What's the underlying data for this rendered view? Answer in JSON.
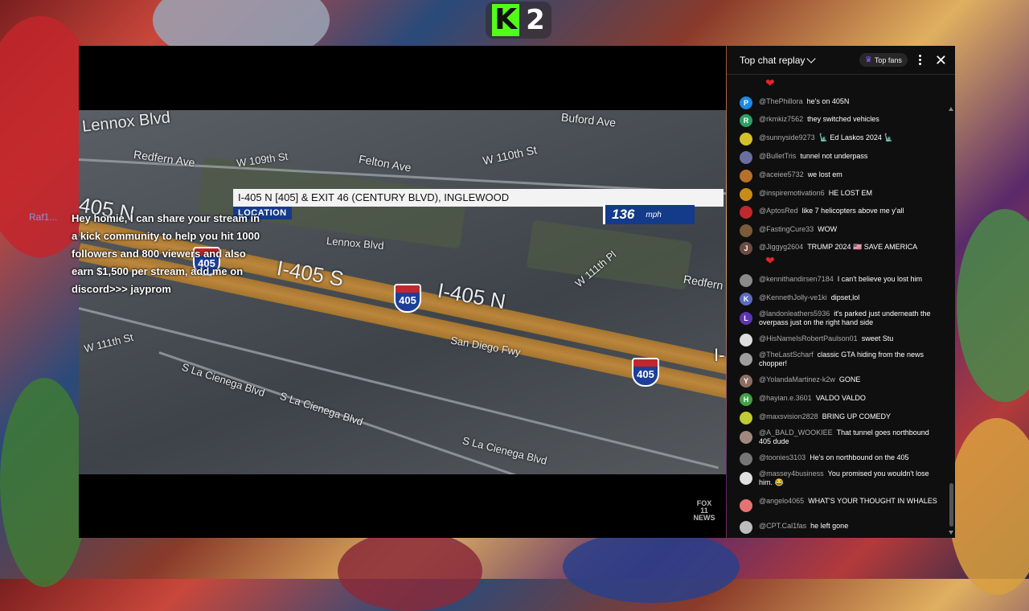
{
  "kick": {
    "logo_text": "K",
    "count": "2",
    "brand_color": "#53fc18"
  },
  "video": {
    "location_text": "I-405 N [405] & EXIT 46 (CENTURY BLVD), INGLEWOOD",
    "location_tag": "LOCATION",
    "speed_value": "136",
    "speed_unit": "mph",
    "map_labels": [
      "Lennox Blvd",
      "Redfern Ave",
      "W 109th St",
      "Felton Ave",
      "W 110th St",
      "Buford Ave",
      "405 N",
      "Lennox Blvd",
      "I-405 S",
      "I-405 N",
      "W 111th Pl",
      "Redfern",
      "W 111th St",
      "San Diego Fwy",
      "S La Cienega Blvd",
      "S La Cienega Blvd",
      "S La Cienega Blvd",
      "I-"
    ],
    "shields": [
      "405",
      "405",
      "405"
    ],
    "channel_logo": "FOX 11 NEWS",
    "overlay_user": "Raf1...",
    "overlay_message": "Hey homie, I can share your stream in a kick community to help you hit 1000 followers and 800 viewers and also earn $1,500 per stream, add me on discord>>> jayprom"
  },
  "chat": {
    "title": "Top chat replay",
    "top_fans_label": "Top fans",
    "messages": [
      {
        "author": "@ThePhillora",
        "text": "he's on 405N",
        "avatar_letter": "P",
        "avatar_color": "#1e88e5"
      },
      {
        "author": "@rkmkiz7562",
        "text": "they switched vehicles",
        "avatar_letter": "R",
        "avatar_color": "#2e9e63"
      },
      {
        "author": "@sunnyside9273",
        "text": "🗽 Ed Laskos 2024 🗽",
        "avatar_letter": "",
        "avatar_color": "#d4c12a"
      },
      {
        "author": "@BulletTris",
        "text": "tunnel not underpass",
        "avatar_letter": "",
        "avatar_color": "#6a6fa0"
      },
      {
        "author": "@aceiee5732",
        "text": "we lost em",
        "avatar_letter": "",
        "avatar_color": "#b5702a"
      },
      {
        "author": "@inspiremotivation6",
        "text": "HE LOST EM",
        "avatar_letter": "",
        "avatar_color": "#c98a1a"
      },
      {
        "author": "@AptosRed",
        "text": "like 7 helicopters above me y'all",
        "avatar_letter": "",
        "avatar_color": "#c0282d"
      },
      {
        "author": "@FastingCure33",
        "text": "WOW",
        "avatar_letter": "",
        "avatar_color": "#7a5a3a"
      },
      {
        "author": "@Jiggyg2604",
        "text": "TRUMP 2024 🇺🇸 SAVE AMERICA",
        "avatar_letter": "J",
        "avatar_color": "#6d4c41"
      },
      {
        "author": "@kennithandirsen7184",
        "text": "I can't believe you lost him",
        "avatar_letter": "",
        "avatar_color": "#8a8a8a"
      },
      {
        "author": "@KennethJolly-ve1ki",
        "text": "dipset,lol",
        "avatar_letter": "K",
        "avatar_color": "#5c6bc0"
      },
      {
        "author": "@landonleathers5936",
        "text": "it's parked just underneath the overpass just on the right hand side",
        "avatar_letter": "L",
        "avatar_color": "#5e35b1"
      },
      {
        "author": "@HisNameIsRobertPaulson01",
        "text": "sweet Stu",
        "avatar_letter": "",
        "avatar_color": "#dddddd"
      },
      {
        "author": "@TheLastScharf",
        "text": "classic GTA hiding from the news chopper!",
        "avatar_letter": "",
        "avatar_color": "#9e9e9e"
      },
      {
        "author": "@YolandaMartinez-k2w",
        "text": "GONE",
        "avatar_letter": "Y",
        "avatar_color": "#8d6e63"
      },
      {
        "author": "@hayian.e.3601",
        "text": "VALDO VALDO",
        "avatar_letter": "H",
        "avatar_color": "#43a047"
      },
      {
        "author": "@maxsvision2828",
        "text": "BRING UP COMEDY",
        "avatar_letter": "",
        "avatar_color": "#c0ca33"
      },
      {
        "author": "@A_BALD_WOOKIEE",
        "text": "That tunnel goes northbound 405 dude",
        "avatar_letter": "",
        "avatar_color": "#a1887f"
      },
      {
        "author": "@toonies3103",
        "text": "He's on northbound on the 405",
        "avatar_letter": "",
        "avatar_color": "#757575"
      },
      {
        "author": "@massey4business",
        "text": "You promised you wouldn't lose him. 😂",
        "avatar_letter": "",
        "avatar_color": "#e0e0e0"
      },
      {
        "author": "@angelo4065",
        "text": "WHAT'S YOUR THOUGHT IN WHALES",
        "avatar_letter": "",
        "avatar_color": "#e57373"
      },
      {
        "author": "@CPT.Cal1fas",
        "text": "he left gone",
        "avatar_letter": "",
        "avatar_color": "#bdbdbd"
      }
    ]
  }
}
